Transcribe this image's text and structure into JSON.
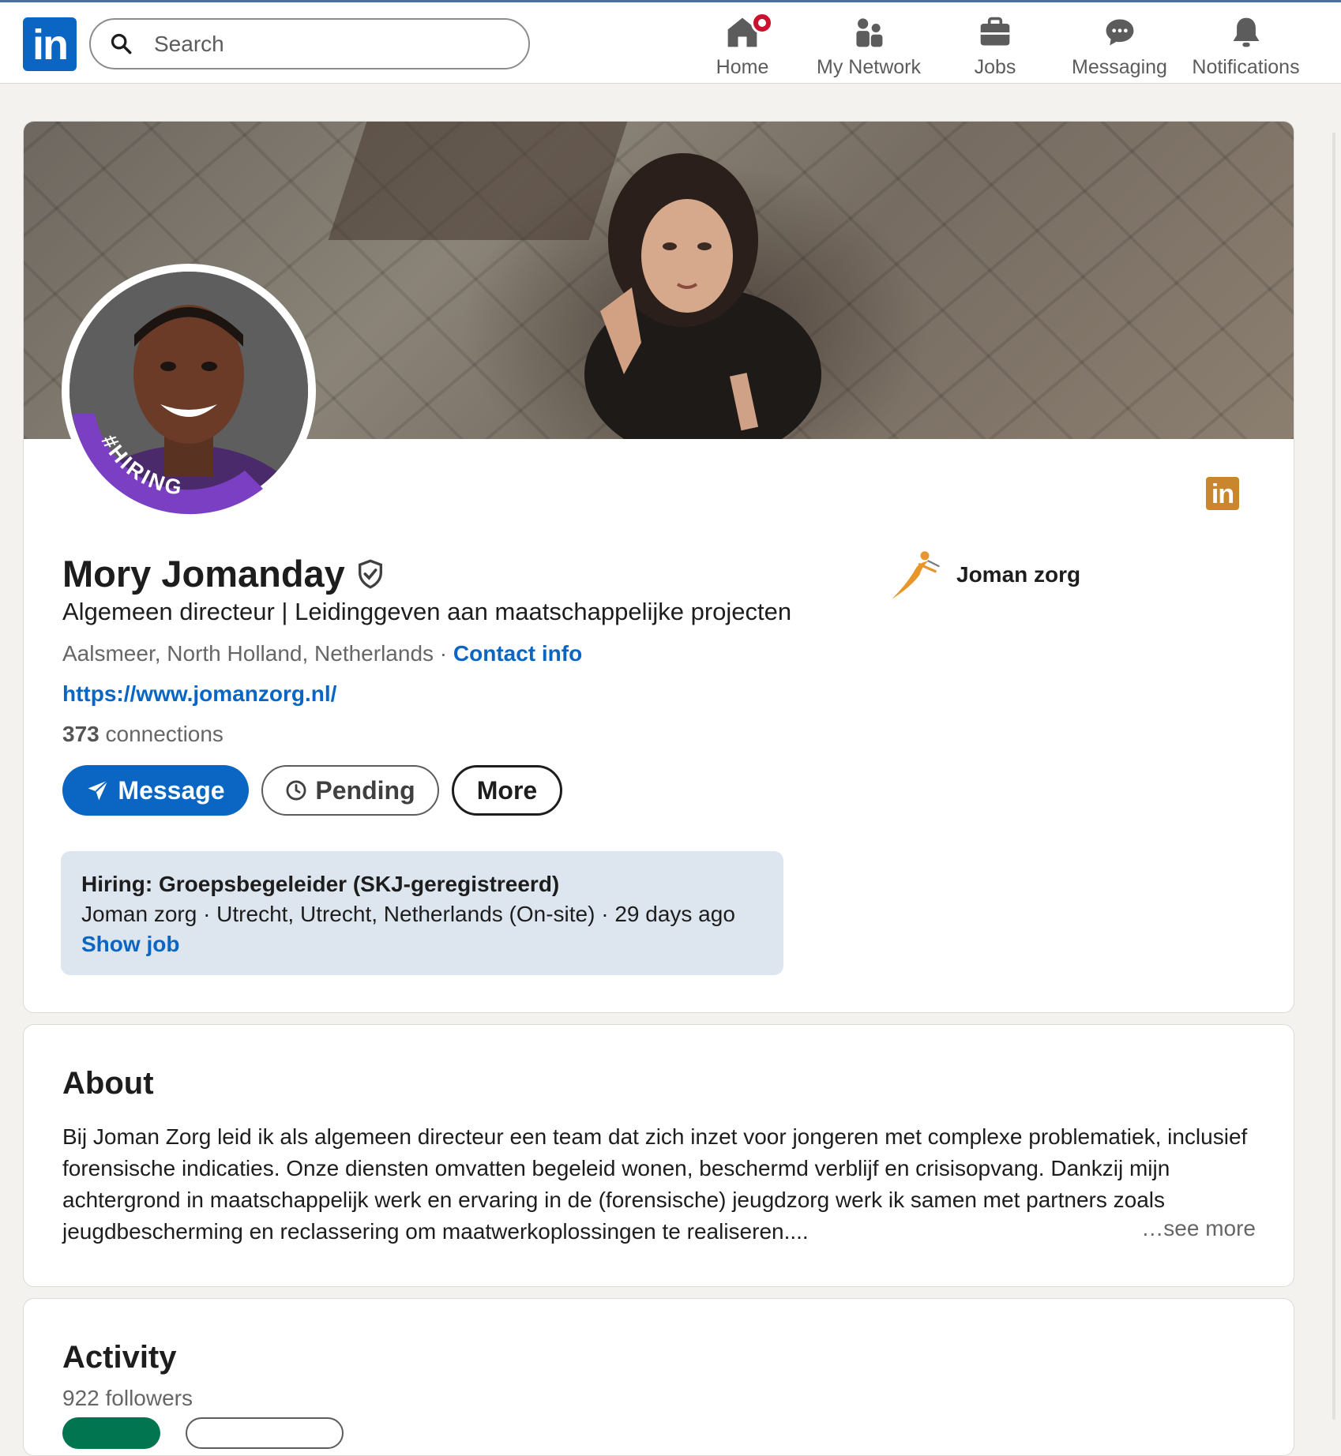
{
  "nav": {
    "logo_text": "in",
    "search_placeholder": "Search",
    "items": [
      {
        "label": "Home",
        "icon": "home-icon"
      },
      {
        "label": "My Network",
        "icon": "my-network-icon"
      },
      {
        "label": "Jobs",
        "icon": "jobs-icon"
      },
      {
        "label": "Messaging",
        "icon": "messaging-icon"
      },
      {
        "label": "Notifications",
        "icon": "notifications-icon"
      }
    ]
  },
  "profile": {
    "avatar_ring_text": "#HIRING",
    "linkedin_badge_text": "in",
    "name": "Mory Jomanday",
    "headline": "Algemeen directeur | Leidinggeven aan maatschappelijke projecten",
    "location": "Aalsmeer, North Holland, Netherlands",
    "separator": " · ",
    "contact_info": "Contact info",
    "website": "https://www.jomanzorg.nl/",
    "connections_count": "373",
    "connections_label": " connections",
    "company": "Joman zorg",
    "buttons": {
      "message": "Message",
      "pending": "Pending",
      "more": "More"
    },
    "hiring": {
      "title": "Hiring: Groepsbegeleider (SKJ-geregistreerd)",
      "details": "Joman zorg · Utrecht, Utrecht, Netherlands (On-site) · 29 days ago",
      "action": "Show job"
    }
  },
  "about": {
    "title": "About",
    "text": "Bij Joman Zorg leid ik als algemeen directeur een team dat zich inzet voor jongeren met complexe problematiek, inclusief forensische indicaties. Onze diensten omvatten begeleid wonen, beschermd verblijf en crisisopvang. Dankzij mijn achtergrond in maatschappelijk werk en ervaring in de (forensische) jeugdzorg werk ik samen met partners zoals jeugdbescherming en reclassering om maatwerkoplossingen te realiseren....",
    "see_more": "…see more"
  },
  "activity": {
    "title": "Activity",
    "followers": "922 followers"
  },
  "colors": {
    "brand_blue": "#0a66c2",
    "hiring_purple": "#7b3fc4",
    "hiring_box": "#dde5ee",
    "notification_red": "#cb112d",
    "company_orange": "#e8952c"
  }
}
